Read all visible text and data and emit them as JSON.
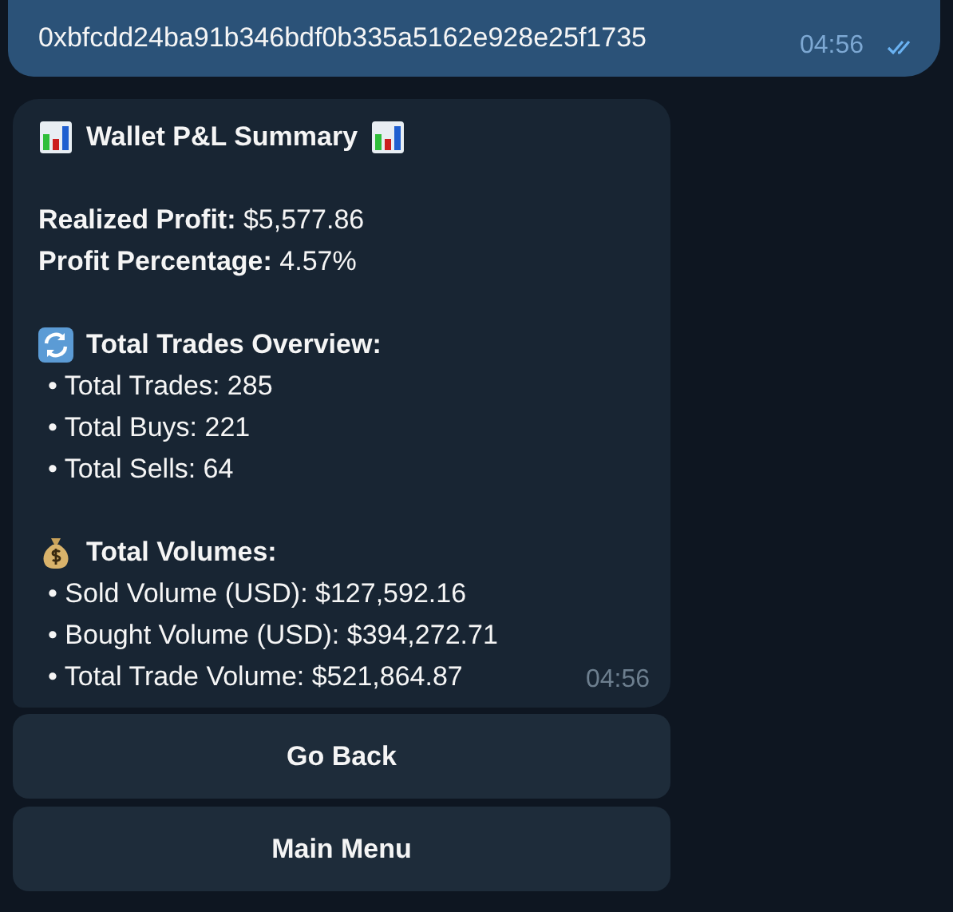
{
  "sent_message": {
    "text": "0xbfcdd24ba91b346bdf0b335a5162e928e25f1735",
    "time": "04:56",
    "read": true
  },
  "reply": {
    "title": "Wallet P&L Summary",
    "summary": [
      "**Realized Profit:** $5,577.86",
      "**Profit Percentage:** 4.57%"
    ],
    "sections": [
      {
        "kind": "refresh",
        "heading": "Total Trades Overview:",
        "items": [
          "• Total Trades: 285",
          "• Total Buys: 221",
          "• Total Sells: 64"
        ]
      },
      {
        "kind": "money-bag",
        "heading": "Total Volumes:",
        "items": [
          "• Sold Volume (USD): $127,592.16",
          "• Bought Volume (USD): $394,272.71",
          "• Total Trade Volume: $521,864.87"
        ]
      }
    ],
    "time": "04:56"
  },
  "buttons": [
    "Go Back",
    "Main Menu"
  ]
}
